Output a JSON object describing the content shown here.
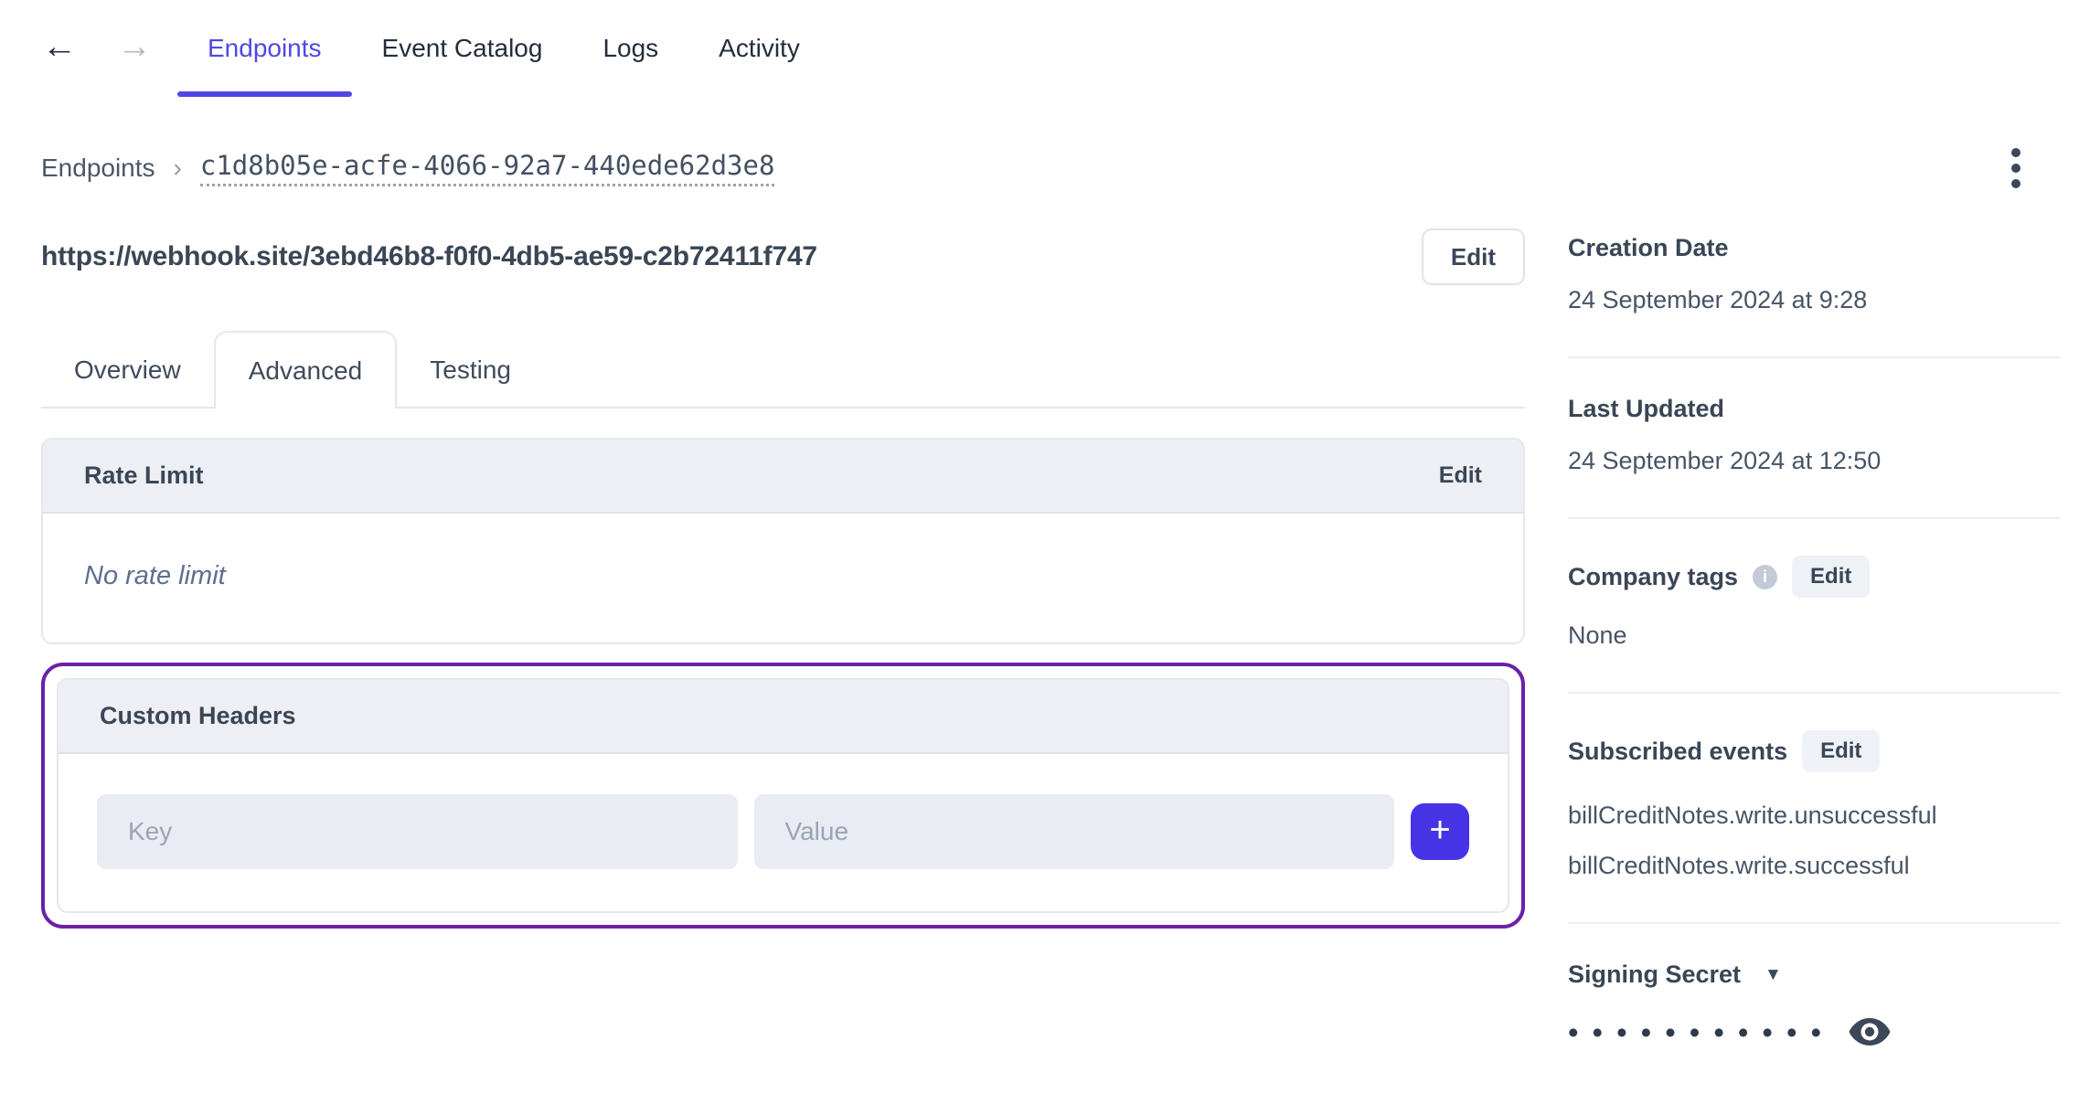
{
  "icons": {
    "back_arrow": "←",
    "forward_arrow": "→",
    "breadcrumb_separator": "›",
    "info": "i",
    "plus": "+",
    "caret_down": "▼"
  },
  "nav": {
    "tabs": [
      {
        "label": "Endpoints",
        "active": true
      },
      {
        "label": "Event Catalog",
        "active": false
      },
      {
        "label": "Logs",
        "active": false
      },
      {
        "label": "Activity",
        "active": false
      }
    ]
  },
  "breadcrumb": {
    "root": "Endpoints",
    "current": "c1d8b05e-acfe-4066-92a7-440ede62d3e8"
  },
  "endpoint": {
    "url": "https://webhook.site/3ebd46b8-f0f0-4db5-ae59-c2b72411f747",
    "edit_label": "Edit"
  },
  "detail_tabs": [
    {
      "label": "Overview",
      "active": false
    },
    {
      "label": "Advanced",
      "active": true
    },
    {
      "label": "Testing",
      "active": false
    }
  ],
  "rate_limit": {
    "title": "Rate Limit",
    "edit_label": "Edit",
    "empty_text": "No rate limit"
  },
  "custom_headers": {
    "title": "Custom Headers",
    "key_placeholder": "Key",
    "value_placeholder": "Value"
  },
  "sidebar": {
    "creation_date": {
      "label": "Creation Date",
      "value": "24 September 2024 at 9:28"
    },
    "last_updated": {
      "label": "Last Updated",
      "value": "24 September 2024 at 12:50"
    },
    "company_tags": {
      "label": "Company tags",
      "edit_label": "Edit",
      "value": "None"
    },
    "subscribed_events": {
      "label": "Subscribed events",
      "edit_label": "Edit",
      "events": [
        "billCreditNotes.write.unsuccessful",
        "billCreditNotes.write.successful"
      ]
    },
    "signing_secret": {
      "label": "Signing Secret",
      "masked_value": "•••••••••••"
    }
  },
  "colors": {
    "accent_indigo": "#5146e6",
    "add_button_indigo": "#4733e6",
    "highlight_purple": "#6b21a8"
  }
}
